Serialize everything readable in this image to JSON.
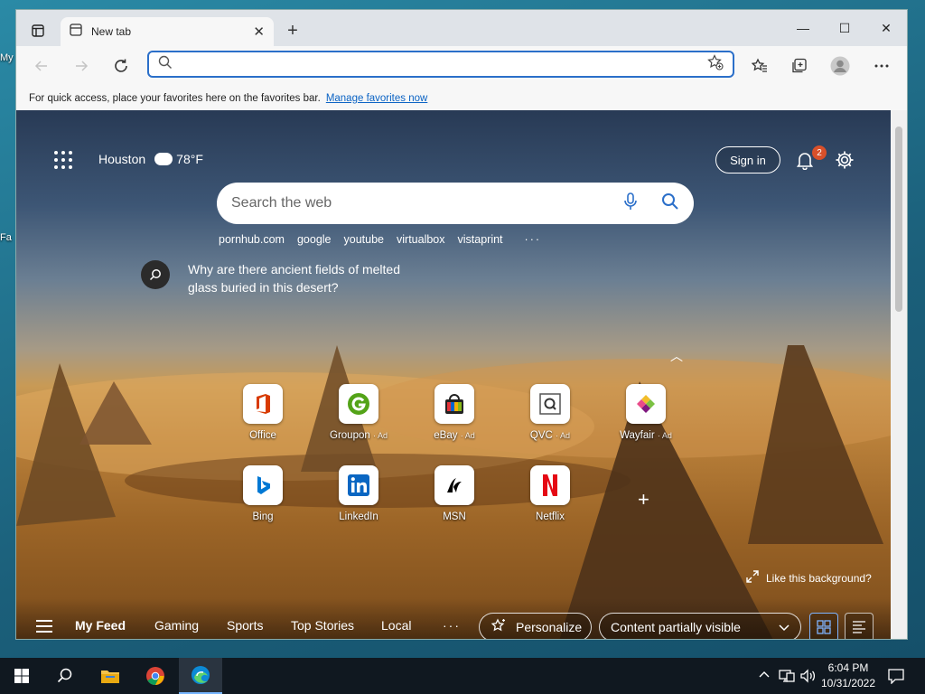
{
  "desktop": {
    "labels": [
      "My",
      "Fa"
    ]
  },
  "browser": {
    "tab": {
      "title": "New tab",
      "close": "✕"
    },
    "new_tab": "+",
    "window_controls": {
      "minimize": "—",
      "maximize": "☐",
      "close": "✕"
    },
    "address": {
      "value": "",
      "placeholder": ""
    },
    "favbar": {
      "message": "For quick access, place your favorites here on the favorites bar.",
      "link": "Manage favorites now"
    }
  },
  "newtab": {
    "weather": {
      "city": "Houston",
      "temp": "78°F"
    },
    "sign_in": "Sign in",
    "notifications": "2",
    "search_placeholder": "Search the web",
    "quick_links": [
      "pornhub.com",
      "google",
      "youtube",
      "virtualbox",
      "vistaprint"
    ],
    "quick_links_more": "···",
    "trivia": "Why are there ancient fields of melted glass buried in this desert?",
    "collapse": "︿",
    "tiles": [
      {
        "label": "Office",
        "ad": "",
        "icon": "office-icon",
        "color": "#d83b01"
      },
      {
        "label": "Groupon",
        "ad": "· Ad",
        "icon": "groupon-icon",
        "color": "#53a318"
      },
      {
        "label": "eBay",
        "ad": "· Ad",
        "icon": "ebay-icon",
        "color": "#e53238"
      },
      {
        "label": "QVC",
        "ad": "· Ad",
        "icon": "qvc-icon",
        "color": "#444444"
      },
      {
        "label": "Wayfair",
        "ad": "· Ad",
        "icon": "wayfair-icon",
        "color": "#7f187f"
      },
      {
        "label": "Bing",
        "ad": "",
        "icon": "bing-icon",
        "color": "#0078d4"
      },
      {
        "label": "LinkedIn",
        "ad": "",
        "icon": "linkedin-icon",
        "color": "#0a66c2"
      },
      {
        "label": "MSN",
        "ad": "",
        "icon": "msn-icon",
        "color": "#000000"
      },
      {
        "label": "Netflix",
        "ad": "",
        "icon": "netflix-icon",
        "color": "#e50914"
      }
    ],
    "add_tile": "+",
    "like_bg": "Like this background?",
    "feed": {
      "tabs": [
        "My Feed",
        "Gaming",
        "Sports",
        "Top Stories",
        "Local"
      ],
      "more": "···",
      "personalize": "Personalize",
      "visibility": "Content partially visible"
    }
  },
  "taskbar": {
    "time": "6:04 PM",
    "date": "10/31/2022"
  }
}
